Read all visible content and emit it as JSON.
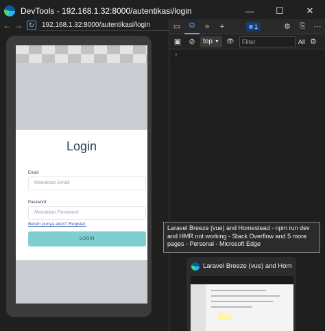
{
  "window": {
    "title": "DevTools - 192.168.1.32:8000/autentikasi/login",
    "controls": {
      "minimize": "—",
      "maximize": "☐",
      "close": "✕"
    }
  },
  "address": {
    "back": "←",
    "forward": "→",
    "reload": "↻",
    "url": "192.168.1.32:8000/autentikasi/login"
  },
  "page": {
    "heading": "Login",
    "email_label": "Email",
    "email_placeholder": "Masukkan Email",
    "password_label": "Password",
    "password_placeholder": "Masukkan Password",
    "register_link": "Belum punya akun? Register.",
    "login_button": "LOGIN"
  },
  "devtools": {
    "tabs": [
      "▭",
      "⧉",
      "»",
      "+"
    ],
    "issues_count": "1",
    "context": "top",
    "context_arrow": "▼",
    "filter_placeholder": "Filter",
    "levels": "All",
    "prompt": "›",
    "icons": {
      "settings": "⚙",
      "connect": "⎘",
      "more": "⋯",
      "sidebar": "▣",
      "clear": "⊘",
      "eye": "👁",
      "console_settings": "⚙"
    }
  },
  "tooltip": {
    "text": "Laravel Breeze (vue) and Homestead - npm run dev and HMR not working - Stack Overflow and 5 more pages - Personal - Microsoft Edge"
  },
  "taskbar_preview": {
    "title": "Laravel Breeze (vue) and Homem..."
  }
}
